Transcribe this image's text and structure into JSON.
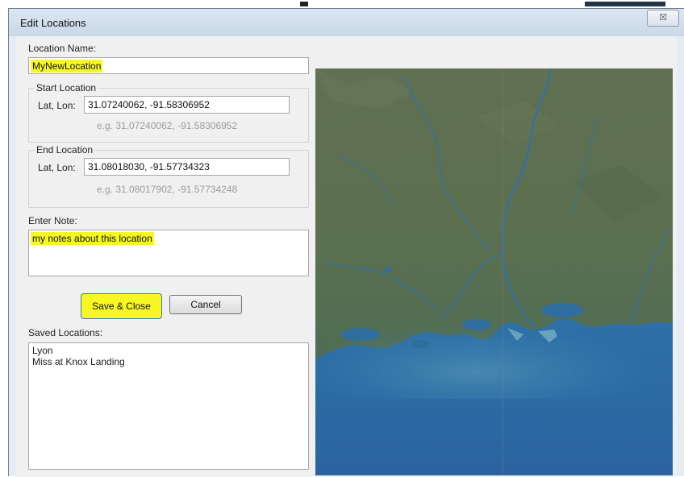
{
  "window": {
    "title": "Edit Locations",
    "close_glyph": "☒"
  },
  "form": {
    "location_name_label": "Location Name:",
    "location_name_value": "MyNewLocation",
    "start_group_label": "Start Location",
    "start_latlon_label": "Lat, Lon:",
    "start_latlon_value": "31.07240062, -91.58306952",
    "start_example": "e.g. 31.07240062, -91.58306952",
    "end_group_label": "End Location",
    "end_latlon_label": "Lat, Lon:",
    "end_latlon_value": "31.08018030, -91.57734323",
    "end_example": "e.g. 31.08017902, -91.57734248",
    "note_label": "Enter Note:",
    "note_value": "my notes about this location"
  },
  "buttons": {
    "save_close": "Save & Close",
    "cancel": "Cancel"
  },
  "saved_locations": {
    "label": "Saved Locations:",
    "items": [
      "Lyon",
      "Miss at Knox Landing"
    ]
  },
  "colors": {
    "highlight": "#f7f724",
    "land": "#5d7150",
    "water": "#2e6fa3"
  },
  "icons": {
    "close": "close-icon",
    "map": "satellite-map"
  }
}
